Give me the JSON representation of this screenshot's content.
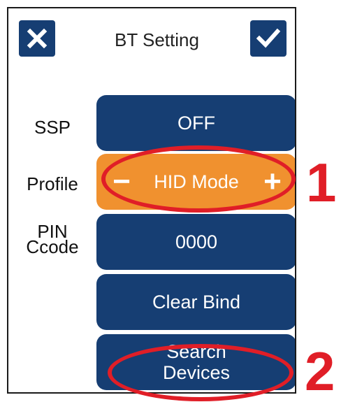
{
  "header": {
    "title": "BT Setting",
    "close_icon": "close-x-icon",
    "confirm_icon": "checkmark-icon"
  },
  "rows": {
    "ssp": {
      "label": "SSP",
      "value": "OFF"
    },
    "profile": {
      "label": "Profile",
      "value": "HID Mode"
    },
    "pin": {
      "label_line1": "PIN",
      "label_line2": "Ccode",
      "value": "0000"
    }
  },
  "buttons": {
    "clear_bind": "Clear Bind",
    "search_line1": "Search",
    "search_line2": "Devices"
  },
  "annotations": {
    "marker1": "1",
    "marker2": "2"
  },
  "colors": {
    "primary": "#163e73",
    "accent": "#f0912f",
    "annotation": "#e01e27"
  }
}
